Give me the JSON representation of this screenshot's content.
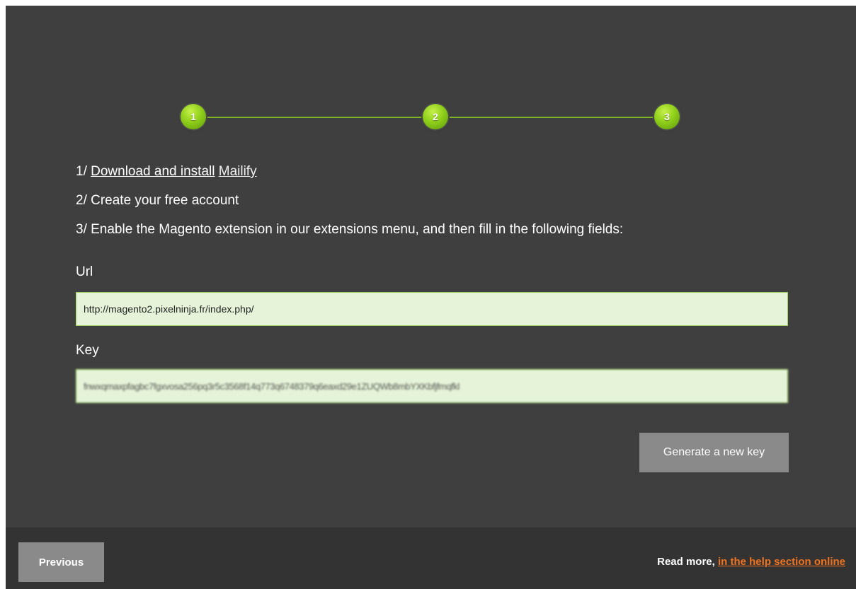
{
  "stepper": {
    "steps": [
      {
        "label": "1"
      },
      {
        "label": "2"
      },
      {
        "label": "3"
      }
    ],
    "accent_color": "#8fcf1a"
  },
  "instructions": {
    "line1_prefix": "1/ ",
    "line1_link": "Download and install",
    "line1_brand": "Mailify",
    "line2": "2/ Create your free account",
    "line3": "3/ Enable the Magento extension in our extensions menu, and then fill in the following fields:"
  },
  "fields": {
    "url_label": "Url",
    "url_value": "http://magento2.pixelninja.fr/index.php/",
    "key_label": "Key",
    "key_value": "fnwxqmaxpfagbc7fgxvosa256pq3r5c3568f14q773q6748379q6eaxd29e1ZUQWb8mbYXKbfjfmqfkl"
  },
  "actions": {
    "generate_label": "Generate a new key"
  },
  "footer": {
    "previous_label": "Previous",
    "read_more_text": "Read more, ",
    "help_link_text": "in the help section online",
    "link_color": "#f0731f"
  }
}
